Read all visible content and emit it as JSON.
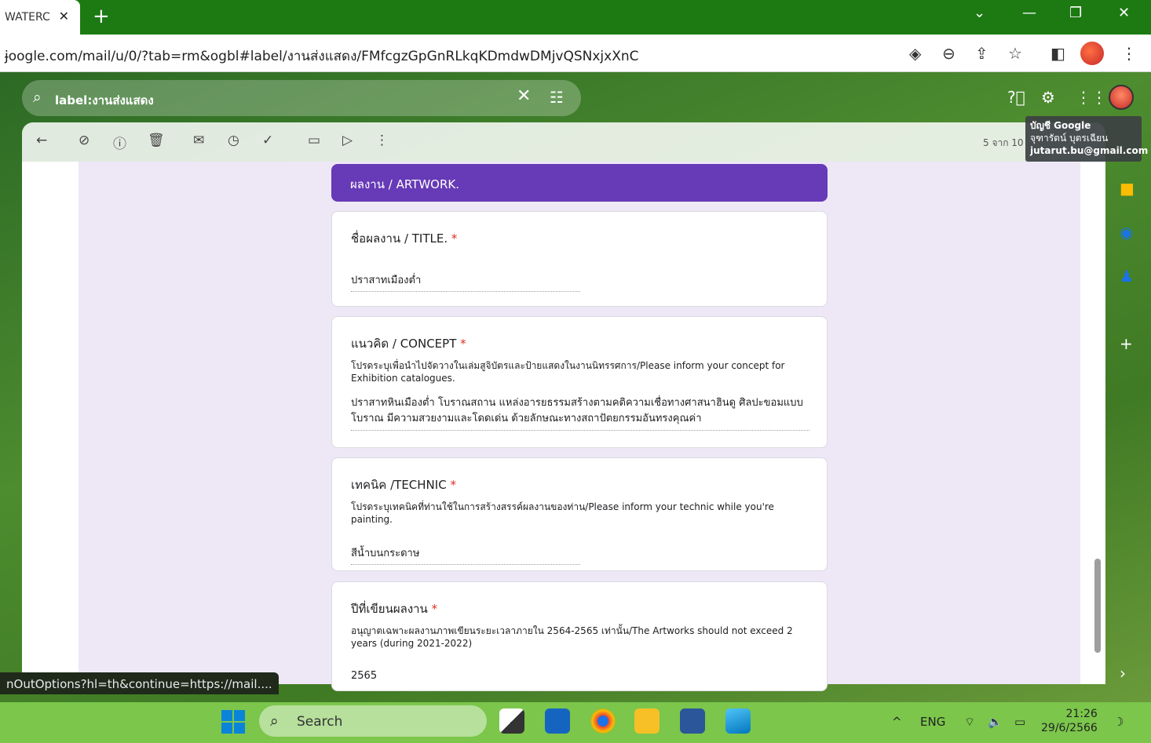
{
  "browser": {
    "tab_title": "WATERC",
    "tab_close": "✕",
    "new_tab": "+",
    "url": "ɉoogle.com/mail/u/0/?tab=rm&ogbl#label/งานส่งแสดง/FMfcgzGpGnRLkqKDmdwDMjvQSNxjxXnC"
  },
  "gmail": {
    "search_value": "label:งานส่งแสดง",
    "account_tooltip": {
      "line1": "บัญชี Google",
      "line2": "จุฑารัตน์ บุตรเฉียน",
      "line3": "jutarut.bu@gmail.com"
    },
    "pager": "5 จาก 10"
  },
  "form": {
    "section": "ผลงาน  / ARTWORK.",
    "questions": [
      {
        "title": "ชื่อผลงาน / TITLE.",
        "required": "*",
        "desc": "",
        "answer": "ปราสาทเมืองต่ำ"
      },
      {
        "title": "แนวคิด / CONCEPT",
        "required": "*",
        "desc": "โปรดระบุเพื่อนำไปจัดวางในเล่มสูจิบัตรและป้ายแสดงในงานนิทรรศการ/Please inform your concept for Exhibition catalogues.",
        "answer": "ปราสาทหินเมืองต่ำ โบราณสถาน แหล่งอารยธรรมสร้างตามคติความเชื่อทางศาสนาฮินดู ศิลปะขอมแบบโบราณ มีความสวยงามและโดดเด่น ด้วยลักษณะทางสถาปัตยกรรมอันทรงคุณค่า"
      },
      {
        "title": "เทคนิค /TECHNIC",
        "required": "*",
        "desc": "โปรดระบุเทคนิคที่ท่านใช้ในการสร้างสรรค์ผลงานของท่าน/Please inform your technic while you're painting.",
        "answer": "สีน้ำบนกระดาษ"
      },
      {
        "title": "ปีที่เขียนผลงาน ",
        "required": "*",
        "desc": "อนุญาตเฉพาะผลงานภาพเขียนระยะเวลาภายใน 2564-2565 เท่านั้น/The Artworks should not exceed 2 years (during 2021-2022)",
        "answer": "2565"
      }
    ]
  },
  "status_url": "nOutOptions?hl=th&continue=https://mail....",
  "taskbar": {
    "search_label": "Search",
    "lang": "ENG",
    "time": "21:26",
    "date": "29/6/2566"
  },
  "colors": {
    "form_header": "#673ab7",
    "form_bg": "#ede7f6",
    "taskbar": "#7bc64b",
    "tab_strip": "#1d7a13"
  }
}
